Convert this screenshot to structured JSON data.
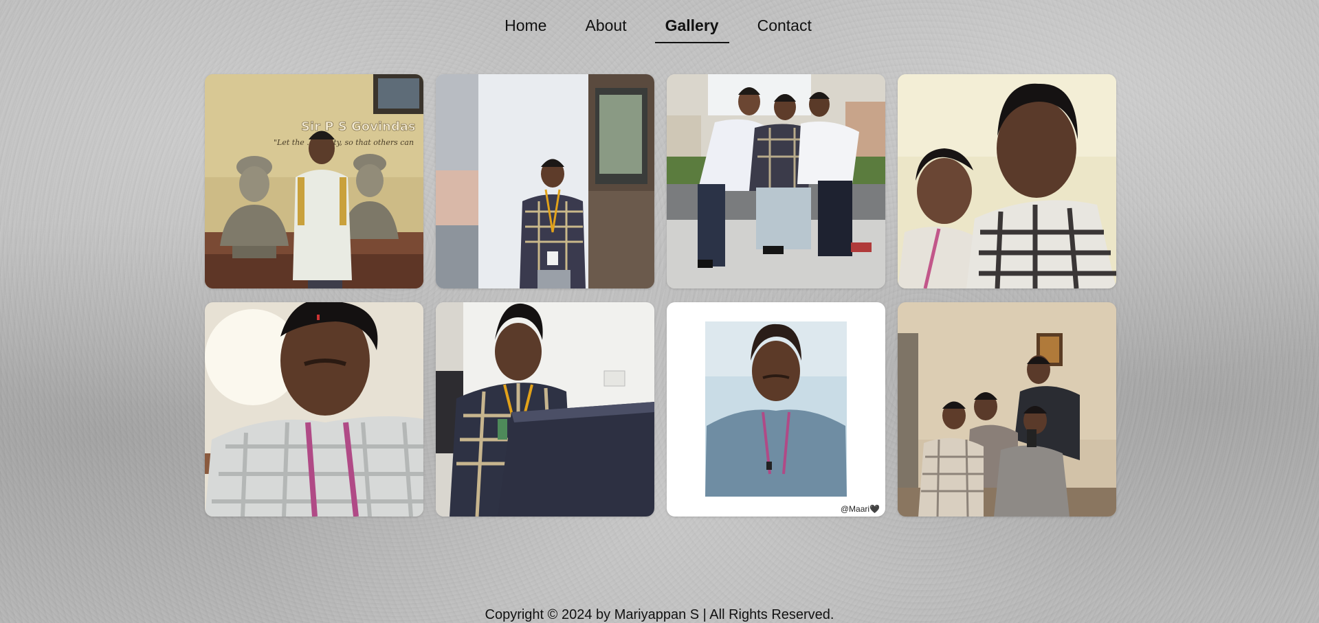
{
  "nav": {
    "items": [
      {
        "label": "Home",
        "active": false
      },
      {
        "label": "About",
        "active": false
      },
      {
        "label": "Gallery",
        "active": true
      },
      {
        "label": "Contact",
        "active": false
      }
    ]
  },
  "gallery": {
    "photos": [
      {
        "subject": "student standing between two bronze busts under a wall inscription",
        "sign_text": "Sir P S Govindas",
        "sign_quote": "\"Let the ... clarity, so that others can"
      },
      {
        "subject": "student with orange lanyard standing against a white wall"
      },
      {
        "subject": "three students sitting on a ledge looking at a phone"
      },
      {
        "subject": "selfie of two students"
      },
      {
        "subject": "close-up selfie of a student with pink lanyard"
      },
      {
        "subject": "student sitting at a laptop"
      },
      {
        "subject": "student selfie in a white frame",
        "watermark": "@Maari🖤"
      },
      {
        "subject": "group of four students posing indoors"
      }
    ]
  },
  "footer": {
    "copyright": "Copyright © 2024 by Mariyappan S | All Rights Reserved."
  }
}
